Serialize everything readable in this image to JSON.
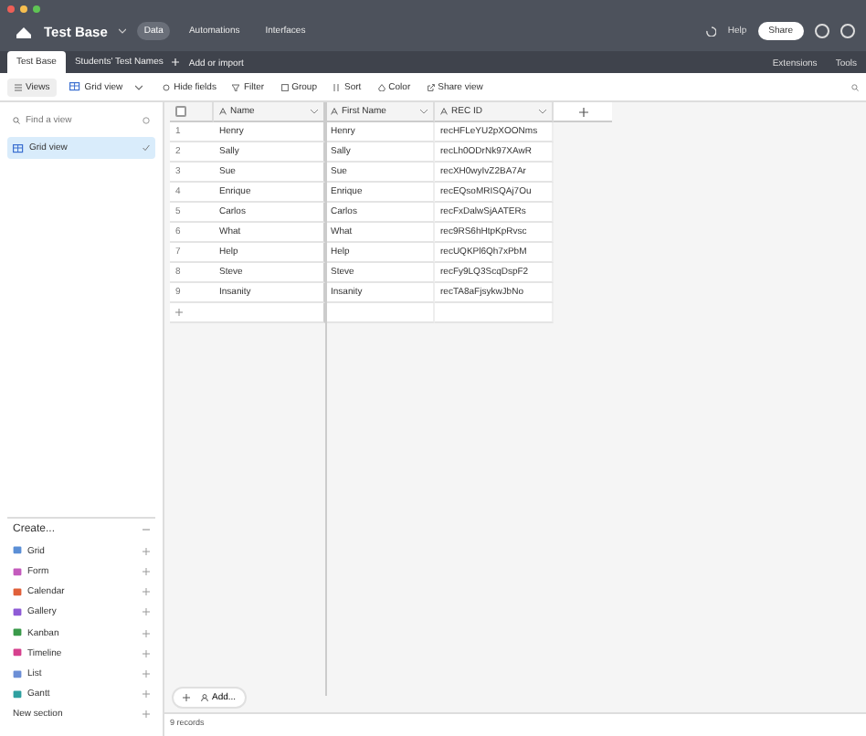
{
  "topbar": {
    "base_name": "Test Base",
    "nav": [
      {
        "label": "Data",
        "selected": true
      },
      {
        "label": "Automations",
        "selected": false
      },
      {
        "label": "Interfaces",
        "selected": false
      }
    ],
    "help": "Help",
    "share": "Share"
  },
  "tabs": {
    "items": [
      {
        "label": "Test Base",
        "selected": true
      },
      {
        "label": "Students' Test Names",
        "selected": false
      }
    ],
    "add": "Add or import",
    "right": [
      "Extensions",
      "Tools"
    ]
  },
  "toolbar": {
    "views": "Views",
    "view_name": "Grid view",
    "buttons": [
      "Hide fields",
      "Filter",
      "Group",
      "Sort",
      "Color",
      "Share view"
    ]
  },
  "sidebar": {
    "search": {
      "placeholder": "Find a view"
    },
    "views": [
      {
        "label": "Grid view",
        "selected": true
      }
    ],
    "create_title": "Create...",
    "create_items": [
      {
        "label": "Grid",
        "kind": "view",
        "color": "#5b8fd6"
      },
      {
        "label": "Form",
        "kind": "view",
        "color": "#c45bbd"
      },
      {
        "label": "Calendar",
        "kind": "view",
        "color": "#e0603a"
      },
      {
        "label": "Gallery",
        "kind": "view",
        "color": "#8e5bd6"
      },
      {
        "label": "Kanban",
        "kind": "view",
        "color": "#3a9a4a"
      },
      {
        "label": "Timeline",
        "kind": "view",
        "color": "#d6418e"
      },
      {
        "label": "List",
        "kind": "view",
        "color": "#6c8fd6"
      },
      {
        "label": "Gantt",
        "kind": "view",
        "color": "#2fa0a0"
      },
      {
        "label": "New section",
        "kind": "section"
      }
    ]
  },
  "grid": {
    "select_all": {
      "checked": false
    },
    "columns": [
      "Name",
      "First Name",
      "REC ID"
    ],
    "rows": [
      {
        "number": "1",
        "cells": [
          "Henry",
          "Henry",
          "recHFLeYU2pXOONms"
        ]
      },
      {
        "number": "2",
        "cells": [
          "Sally",
          "Sally",
          "recLh0ODrNk97XAwR"
        ]
      },
      {
        "number": "3",
        "cells": [
          "Sue",
          "Sue",
          "recXH0wyIvZ2BA7Ar"
        ]
      },
      {
        "number": "4",
        "cells": [
          "Enrique",
          "Enrique",
          "recEQsoMRISQAj7Ou"
        ]
      },
      {
        "number": "5",
        "cells": [
          "Carlos",
          "Carlos",
          "recFxDalwSjAATERs"
        ]
      },
      {
        "number": "6",
        "cells": [
          "What",
          "What",
          "rec9RS6hHtpKpRvsc"
        ]
      },
      {
        "number": "7",
        "cells": [
          "Help",
          "Help",
          "recUQKPl6Qh7xPbM"
        ]
      },
      {
        "number": "8",
        "cells": [
          "Steve",
          "Steve",
          "recFy9LQ3ScqDspF2"
        ]
      },
      {
        "number": "9",
        "cells": [
          "Insanity",
          "Insanity",
          "recTA8aFjsykwJbNo"
        ]
      }
    ]
  },
  "footer": {
    "add": "Add...",
    "records": "9 records"
  }
}
